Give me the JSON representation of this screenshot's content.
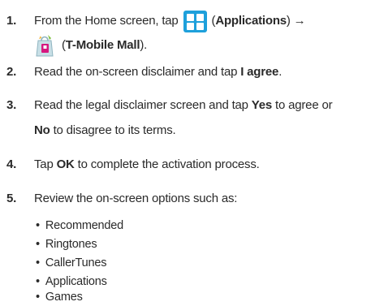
{
  "steps": [
    {
      "number": "1.",
      "text_a": "From the Home screen, tap ",
      "text_b": " (",
      "bold_b": "Applications",
      "text_c": ") →",
      "text_d": "(",
      "bold_d": "T-Mobile Mall",
      "text_e": ").",
      "icons": [
        "applications-icon",
        "t-mobile-mall-icon"
      ]
    },
    {
      "number": "2.",
      "text_a": "Read the on-screen disclaimer and tap ",
      "bold_a": "I agree",
      "text_b": "."
    },
    {
      "number": "3.",
      "text_a": "Read the legal disclaimer screen and tap ",
      "bold_a": "Yes",
      "text_b": " to agree or",
      "bold_c": "No",
      "text_c": " to disagree to its terms."
    },
    {
      "number": "4.",
      "text_a": "Tap ",
      "bold_a": "OK",
      "text_b": " to complete the activation process."
    },
    {
      "number": "5.",
      "text_a": "Review the on-screen options such as:"
    }
  ],
  "bullet_char": "•",
  "options": [
    "Recommended",
    "Ringtones",
    "CallerTunes",
    "Applications",
    "Games"
  ],
  "colors": {
    "text": "#2a2a2a",
    "applications_icon": "#1ea0db",
    "mall_bag": "#c8dfe6",
    "mall_accent": "#d6177f"
  }
}
